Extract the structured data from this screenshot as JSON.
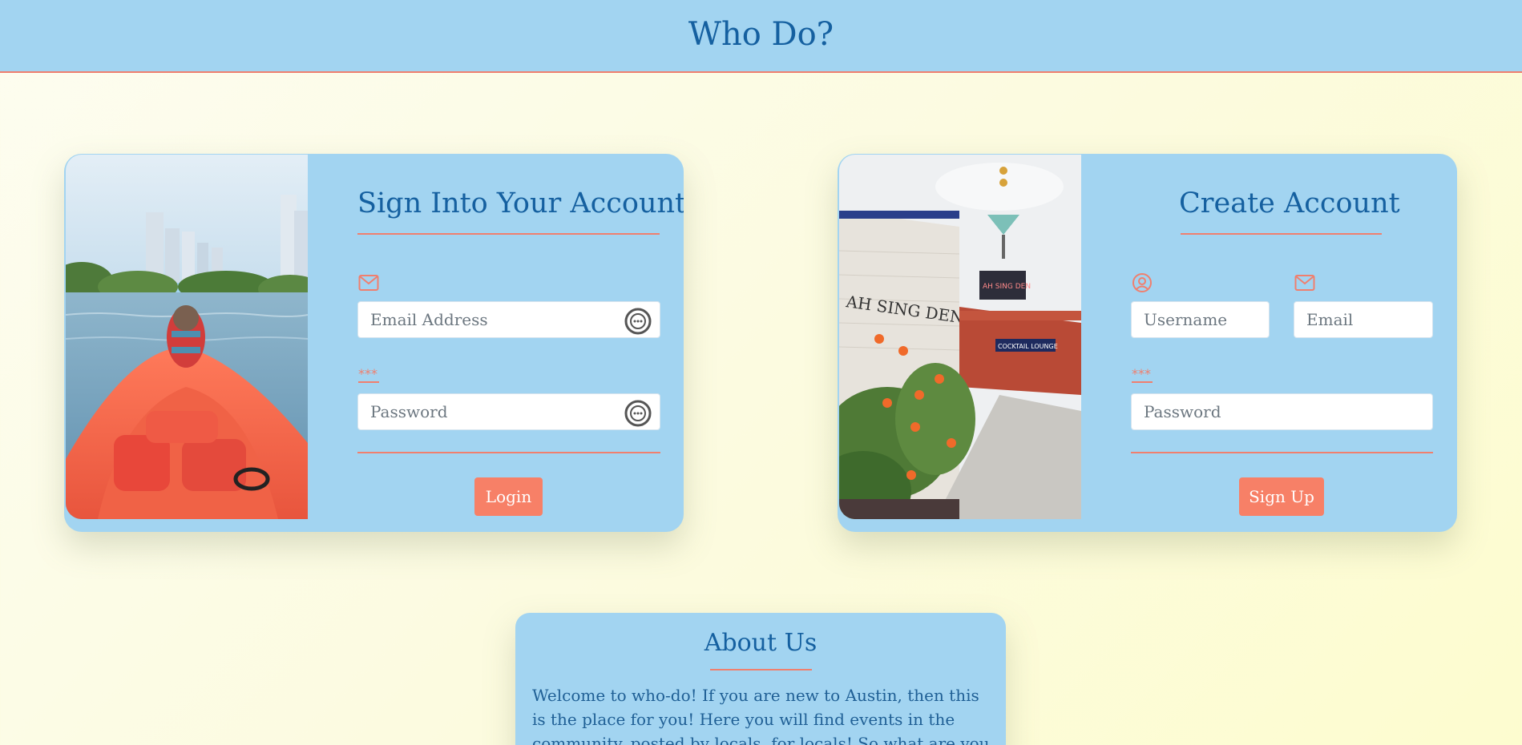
{
  "header": {
    "title": "Who Do?"
  },
  "signin": {
    "title": "Sign Into Your Account",
    "email_icon": "envelope-icon",
    "password_icon": "asterisks-icon",
    "email_placeholder": "Email Address",
    "password_placeholder": "Password",
    "button_label": "Login",
    "photo": "kayak-dog-lake-skyline-photo"
  },
  "signup": {
    "title": "Create Account",
    "username_icon": "user-circle-icon",
    "email_icon": "envelope-icon",
    "password_icon": "asterisks-icon",
    "username_placeholder": "Username",
    "email_placeholder": "Email",
    "password_placeholder": "Password",
    "button_label": "Sign Up",
    "photo": "storefront-street-photo",
    "sign_text_1": "AH SING DEN",
    "sign_text_2": "COCKTAIL LOUNGE"
  },
  "about": {
    "title": "About Us",
    "text": "Welcome to who-do! If you are new to Austin, then this is the place for you! Here you will find events in the community, posted by locals, for locals! So what are you waiting for?"
  },
  "colors": {
    "header_bg": "#a2d4f1",
    "accent": "#f07f6e",
    "button": "#f78067",
    "title_text": "#1560a0"
  }
}
